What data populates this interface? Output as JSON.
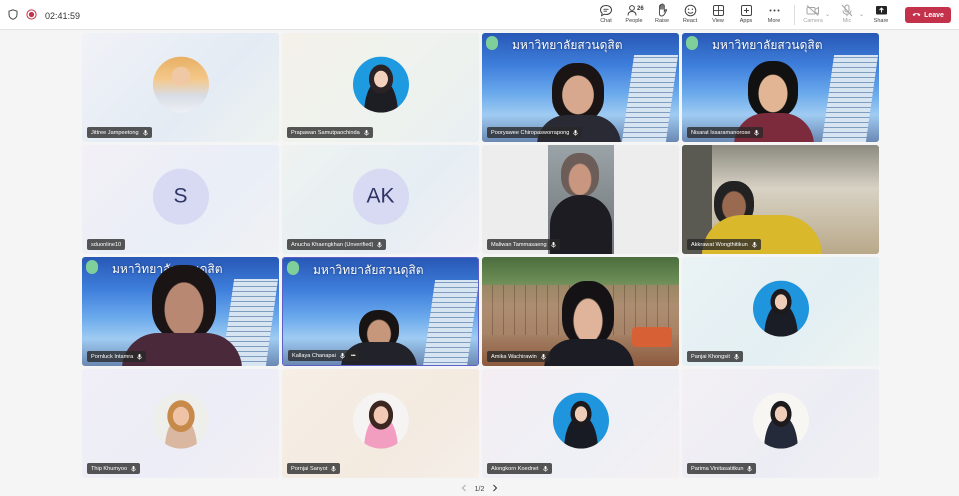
{
  "toolbar": {
    "timer": "02:41:59",
    "buttons": [
      {
        "label": "Chat",
        "icon": "chat-icon"
      },
      {
        "label": "People",
        "icon": "people-icon",
        "badge": "26"
      },
      {
        "label": "Raise",
        "icon": "raise-hand-icon"
      },
      {
        "label": "React",
        "icon": "react-icon"
      },
      {
        "label": "View",
        "icon": "view-icon"
      },
      {
        "label": "Apps",
        "icon": "apps-icon"
      },
      {
        "label": "More",
        "icon": "more-icon"
      },
      {
        "label": "Camera",
        "icon": "camera-off-icon"
      },
      {
        "label": "Mic",
        "icon": "mic-off-icon"
      },
      {
        "label": "Share",
        "icon": "share-icon"
      }
    ],
    "leave_label": "Leave"
  },
  "banner_text": "มหาวิทยาลัยสวนดุสิต",
  "participants": [
    {
      "name": "Jittree Jampeetong",
      "kind": "avatar"
    },
    {
      "name": "Prapawan Samutpaochinda",
      "kind": "avatar"
    },
    {
      "name": "Pooryawee Chiropasworrapong",
      "kind": "video"
    },
    {
      "name": "Nisarat Issaramanorose",
      "kind": "video"
    },
    {
      "name": "sduonline10",
      "kind": "initials",
      "initials": "S"
    },
    {
      "name": "Anucha Khaengkhan (Unverified)",
      "kind": "initials",
      "initials": "AK"
    },
    {
      "name": "Maliwan Tammasaeng",
      "kind": "video"
    },
    {
      "name": "Akkrawat Wongthitikun",
      "kind": "video"
    },
    {
      "name": "Pornluck Intamra",
      "kind": "video"
    },
    {
      "name": "Kallaya Chanapai",
      "kind": "video"
    },
    {
      "name": "Amika Wachirawin",
      "kind": "video"
    },
    {
      "name": "Panjai Khongsit",
      "kind": "avatar"
    },
    {
      "name": "Thip Khumyoo",
      "kind": "avatar"
    },
    {
      "name": "Pornjai Sanyot",
      "kind": "avatar"
    },
    {
      "name": "Alongkorn Koednet",
      "kind": "avatar"
    },
    {
      "name": "Parima Vinitasatitkun",
      "kind": "avatar"
    }
  ],
  "pager": {
    "text": "1/2"
  }
}
